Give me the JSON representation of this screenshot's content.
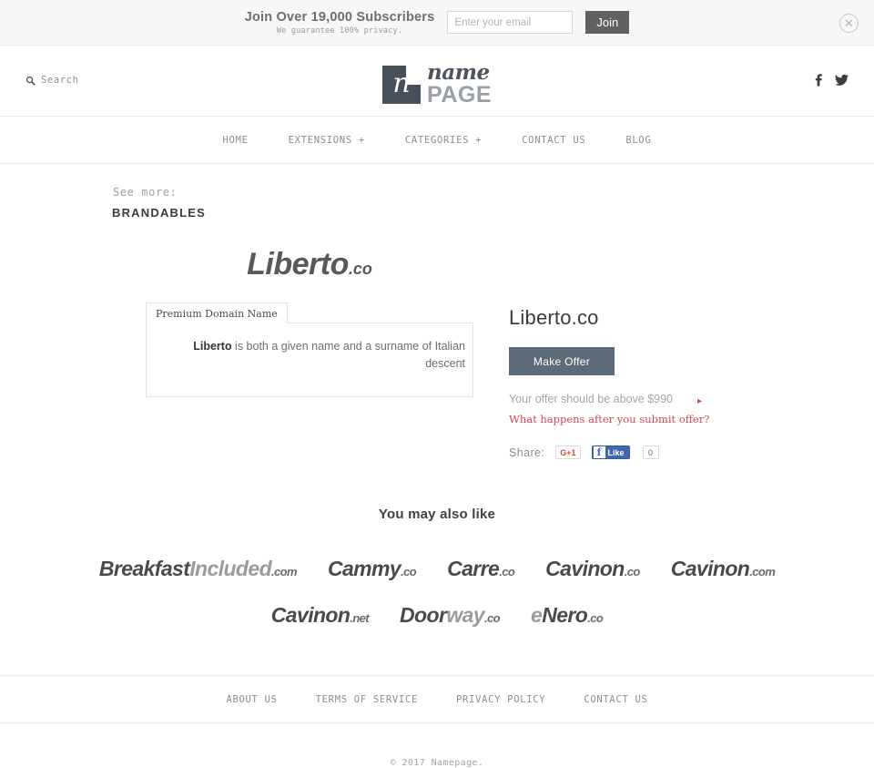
{
  "banner": {
    "title": "Join Over 19,000 Subscribers",
    "subtitle": "We guarantee 100% privacy.",
    "email_placeholder": "Enter your email",
    "email_value": "",
    "join_label": "Join",
    "close_icon": "close-circle-icon"
  },
  "header": {
    "search_label": "Search",
    "search_icon": "search-icon",
    "logo": {
      "mark": "n",
      "name": "name",
      "page": "PAGE"
    },
    "socials": [
      {
        "name": "facebook-icon",
        "label": "f"
      },
      {
        "name": "twitter-icon",
        "label": "t"
      }
    ]
  },
  "nav": {
    "items": [
      {
        "label": "HOME"
      },
      {
        "label": "EXTENSIONS +"
      },
      {
        "label": "CATEGORIES +"
      },
      {
        "label": "CONTACT US"
      },
      {
        "label": "BLOG"
      }
    ]
  },
  "seemore": {
    "label": "See more:",
    "category": "BRANDABLES"
  },
  "product": {
    "logo_main": "Liberto",
    "logo_tld": ".co",
    "tab_label": "Premium Domain Name",
    "desc_bold": "Liberto",
    "desc_rest": " is both a given name and a surname of Italian descent",
    "title": "Liberto.co",
    "offer_button": "Make Offer",
    "offer_note": "Your offer should be above $990",
    "offer_arrow": "▸",
    "offer_link": "What happens after you submit offer?",
    "share_label": "Share:",
    "gplus_label": "G+1",
    "fb_like_label": "Like",
    "fb_count": "0"
  },
  "also_like": {
    "title": "You may also like",
    "items": [
      {
        "dark": "Breakfast",
        "light": "Included",
        "tld": ".com"
      },
      {
        "dark": "Cammy",
        "light": "",
        "tld": ".co"
      },
      {
        "dark": "Carre",
        "light": "",
        "tld": ".co"
      },
      {
        "dark": "Cavinon",
        "light": "",
        "tld": ".co"
      },
      {
        "dark": "Cavinon",
        "light": "",
        "tld": ".com"
      },
      {
        "dark": "Cavinon",
        "light": "",
        "tld": ".net"
      },
      {
        "dark": "Door",
        "light": "way",
        "tld": ".co"
      },
      {
        "dark": "",
        "light": "e",
        "tld": ".co",
        "dark2": "Nero"
      }
    ]
  },
  "footer": {
    "links": [
      {
        "label": "ABOUT US"
      },
      {
        "label": "TERMS OF SERVICE"
      },
      {
        "label": "PRIVACY POLICY"
      },
      {
        "label": "CONTACT US"
      }
    ],
    "copyright": "© 2017 Namepage."
  },
  "colors": {
    "accent_red": "#d04a4a",
    "button_slate": "#5d6b78",
    "logo_navy": "#464f5a",
    "join_gray": "#616161"
  }
}
